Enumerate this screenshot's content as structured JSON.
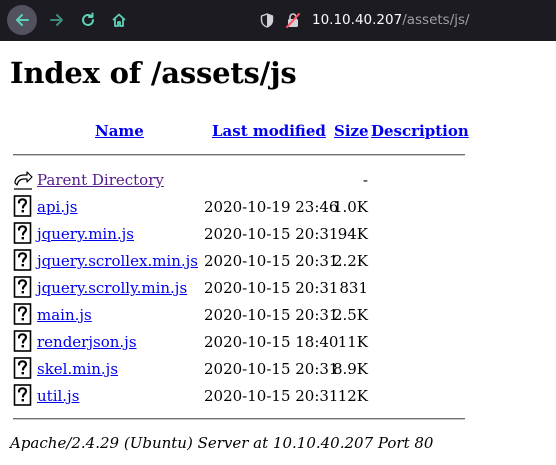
{
  "browser": {
    "url_host": "10.10.40.207",
    "url_path": "/assets/js/"
  },
  "page": {
    "title": "Index of /assets/js",
    "columns": {
      "name": "Name",
      "last_modified": "Last modified",
      "size": "Size",
      "description": "Description"
    },
    "parent": {
      "label": "Parent Directory",
      "size": "-"
    },
    "files": [
      {
        "name": "api.js",
        "modified": "2020-10-19 23:46",
        "size": "1.0K"
      },
      {
        "name": "jquery.min.js",
        "modified": "2020-10-15 20:31",
        "size": "94K"
      },
      {
        "name": "jquery.scrollex.min.js",
        "modified": "2020-10-15 20:31",
        "size": "2.2K"
      },
      {
        "name": "jquery.scrolly.min.js",
        "modified": "2020-10-15 20:31",
        "size": "831"
      },
      {
        "name": "main.js",
        "modified": "2020-10-15 20:31",
        "size": "2.5K"
      },
      {
        "name": "renderjson.js",
        "modified": "2020-10-15 18:40",
        "size": "11K"
      },
      {
        "name": "skel.min.js",
        "modified": "2020-10-15 20:31",
        "size": "8.9K"
      },
      {
        "name": "util.js",
        "modified": "2020-10-15 20:31",
        "size": "12K"
      }
    ],
    "footer": "Apache/2.4.29 (Ubuntu) Server at 10.10.40.207 Port 80"
  },
  "colors": {
    "link": "#0000ee",
    "visited": "#551a8b",
    "toolbar": "#1c1b22",
    "nav_accent": "#4ec9b0"
  }
}
